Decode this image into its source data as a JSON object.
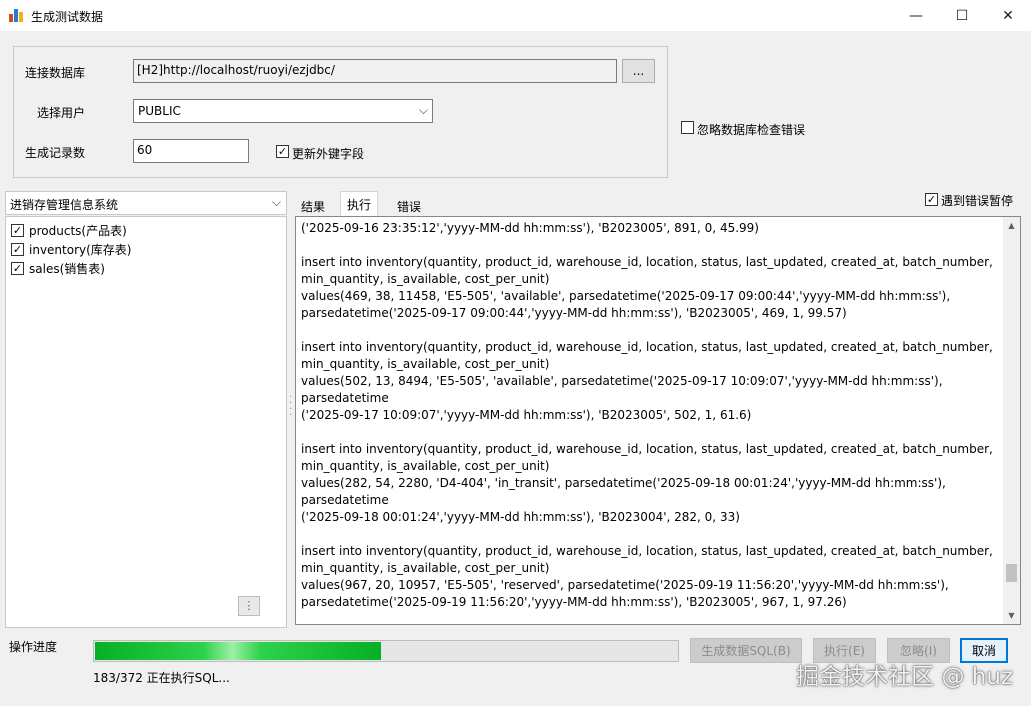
{
  "window": {
    "title": "生成测试数据",
    "minimize": "—",
    "maximize": "☐",
    "close": "✕"
  },
  "connection": {
    "db_label": "连接数据库",
    "db_value": "[H2]http://localhost/ruoyi/ezjdbc/",
    "browse_label": "...",
    "user_label": "选择用户",
    "user_value": "PUBLIC",
    "count_label": "生成记录数",
    "count_value": "60",
    "update_fk_label": "更新外键字段",
    "update_fk_checked": true,
    "ignore_check_label": "忽略数据库检查错误",
    "ignore_check_checked": false
  },
  "tree": {
    "system": "进销存管理信息系统",
    "items": [
      {
        "label": "products(产品表)",
        "checked": true
      },
      {
        "label": "inventory(库存表)",
        "checked": true
      },
      {
        "label": "sales(销售表)",
        "checked": true
      }
    ],
    "grip": "⋮"
  },
  "tabs": [
    {
      "label": "结果",
      "active": false
    },
    {
      "label": "执行",
      "active": true
    },
    {
      "label": "错误",
      "active": false
    }
  ],
  "pause_on_error": {
    "label": "遇到错误暂停",
    "checked": true
  },
  "output": {
    "lines": "('2025-09-16 23:35:12','yyyy-MM-dd hh:mm:ss'), 'B2023005', 891, 0, 45.99)\n\ninsert into inventory(quantity, product_id, warehouse_id, location, status, last_updated, created_at, batch_number,\nmin_quantity, is_available, cost_per_unit)\nvalues(469, 38, 11458, 'E5-505', 'available', parsedatetime('2025-09-17 09:00:44','yyyy-MM-dd hh:mm:ss'),\nparsedatetime('2025-09-17 09:00:44','yyyy-MM-dd hh:mm:ss'), 'B2023005', 469, 1, 99.57)\n\ninsert into inventory(quantity, product_id, warehouse_id, location, status, last_updated, created_at, batch_number,\nmin_quantity, is_available, cost_per_unit)\nvalues(502, 13, 8494, 'E5-505', 'available', parsedatetime('2025-09-17 10:09:07','yyyy-MM-dd hh:mm:ss'), parsedatetime\n('2025-09-17 10:09:07','yyyy-MM-dd hh:mm:ss'), 'B2023005', 502, 1, 61.6)\n\ninsert into inventory(quantity, product_id, warehouse_id, location, status, last_updated, created_at, batch_number,\nmin_quantity, is_available, cost_per_unit)\nvalues(282, 54, 2280, 'D4-404', 'in_transit', parsedatetime('2025-09-18 00:01:24','yyyy-MM-dd hh:mm:ss'), parsedatetime\n('2025-09-18 00:01:24','yyyy-MM-dd hh:mm:ss'), 'B2023004', 282, 0, 33)\n\ninsert into inventory(quantity, product_id, warehouse_id, location, status, last_updated, created_at, batch_number,\nmin_quantity, is_available, cost_per_unit)\nvalues(967, 20, 10957, 'E5-505', 'reserved', parsedatetime('2025-09-19 11:56:20','yyyy-MM-dd hh:mm:ss'),\nparsedatetime('2025-09-19 11:56:20','yyyy-MM-dd hh:mm:ss'), 'B2023005', 967, 1, 97.26)",
    "scroll_position": 0.93
  },
  "progress": {
    "label": "操作进度",
    "fraction": 0.4919,
    "status": "183/372 正在执行SQL..."
  },
  "buttons": {
    "generate_sql": "生成数据SQL(B)",
    "execute": "执行(E)",
    "ignore": "忽略(I)",
    "cancel": "取消"
  },
  "watermark": "掘金技术社区 @ huz",
  "colors": {
    "progress_fill": "#06b025",
    "accent": "#0078d7"
  }
}
